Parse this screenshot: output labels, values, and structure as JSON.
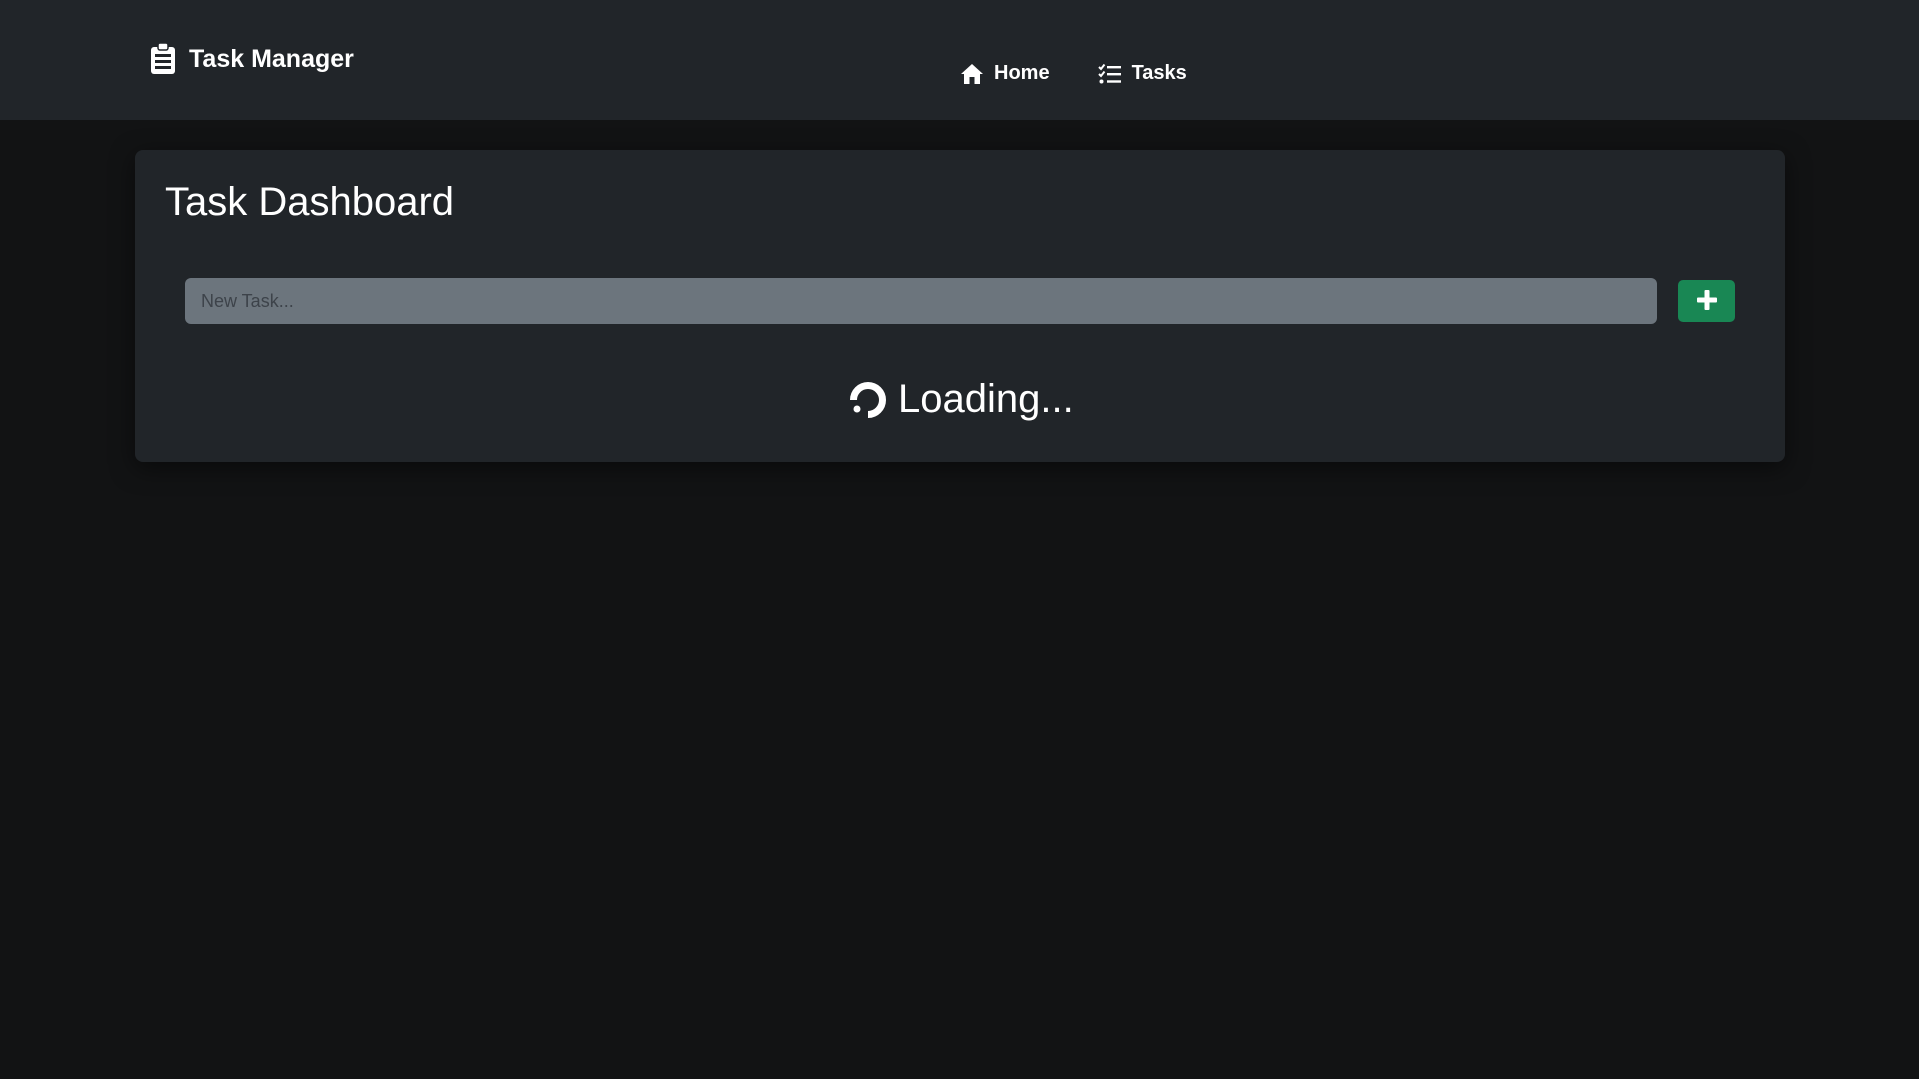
{
  "navbar": {
    "brand": {
      "label": "Task Manager",
      "icon": "clipboard-icon"
    },
    "links": [
      {
        "label": "Home",
        "icon": "home-icon"
      },
      {
        "label": "Tasks",
        "icon": "list-check-icon"
      }
    ]
  },
  "dashboard": {
    "title": "Task Dashboard",
    "new_task_input": {
      "value": "",
      "placeholder": "New Task..."
    },
    "add_button": {
      "icon": "plus-icon"
    },
    "loading": {
      "label": "Loading...",
      "icon": "spinner-icon"
    }
  },
  "colors": {
    "background": "#121314",
    "navbar": "#212529",
    "card": "#212529",
    "input": "#6c757d",
    "accent_green": "#198754",
    "text": "#ffffff"
  }
}
